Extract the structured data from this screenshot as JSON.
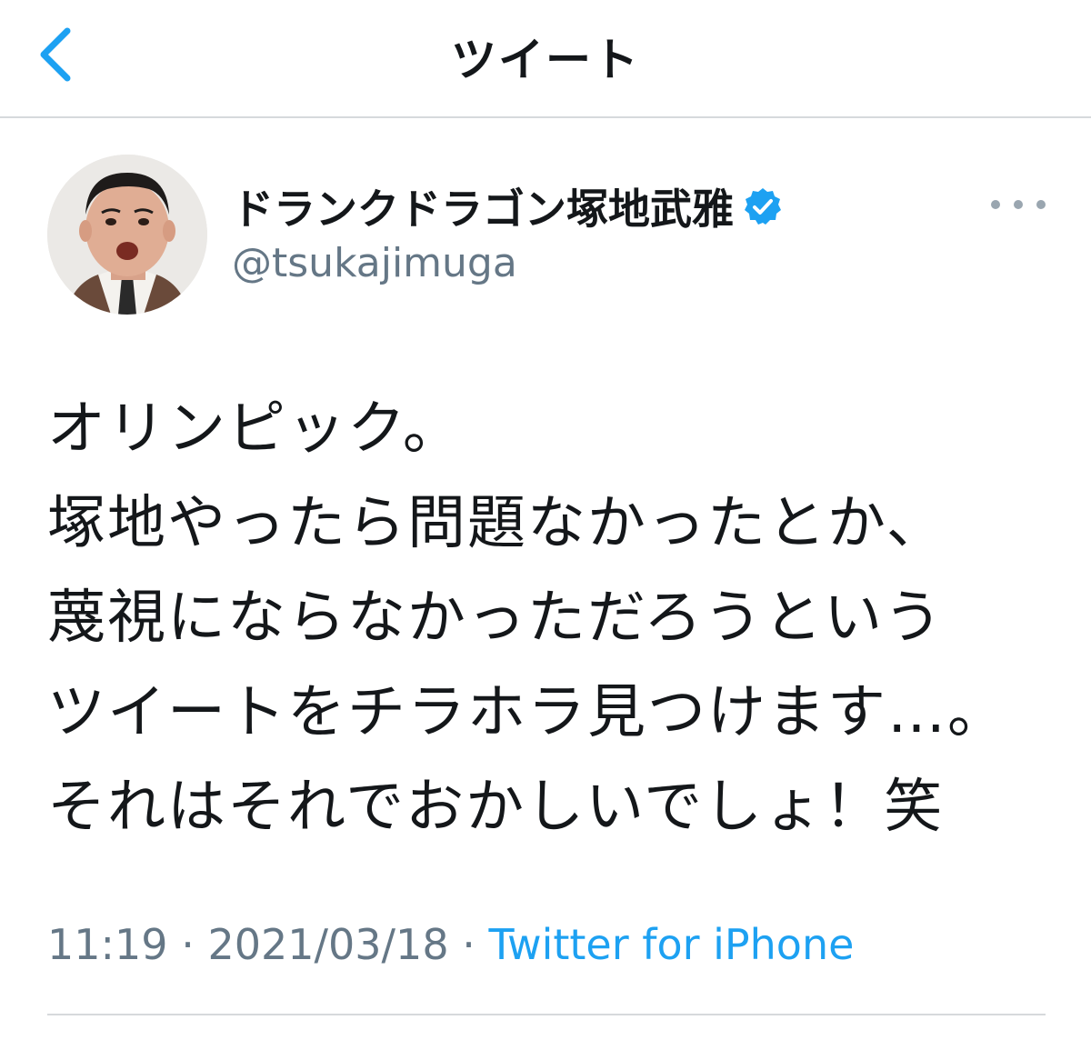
{
  "header": {
    "title": "ツイート",
    "back_icon": "chevron-left-icon"
  },
  "colors": {
    "accent": "#1da1f2",
    "secondary_text": "#657786",
    "divider": "#d6d9dc",
    "verified": "#1da1f2"
  },
  "tweet": {
    "author": {
      "display_name": "ドランクドラゴン塚地武雅",
      "handle": "@tsukajimuga",
      "verified_icon": "verified-badge-icon",
      "avatar_icon": "profile-photo"
    },
    "more_icon": "more-horizontal-icon",
    "lines": [
      "オリンピック。",
      "塚地やったら問題なかったとか、",
      "蔑視にならなかっただろうという",
      "ツイートをチラホラ見つけます…。",
      "それはそれでおかしいでしょ！笑"
    ],
    "time": "11:19",
    "date": "2021/03/18",
    "separator": "·",
    "source": "Twitter for iPhone"
  }
}
